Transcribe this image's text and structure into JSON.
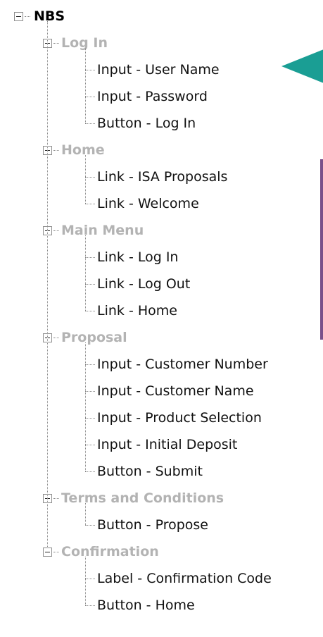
{
  "colors": {
    "root_text": "#000000",
    "group_text": "#b3b3b3",
    "leaf_text": "#111111",
    "connector": "#8a8a8a",
    "annotation_arrow": "#1a9e94",
    "annotation_bar": "#7a4f8a"
  },
  "tree": {
    "root": {
      "label": "NBS",
      "expanded": true,
      "icon": "collapse-icon"
    },
    "groups": [
      {
        "label": "Log In",
        "expanded": true,
        "items": [
          "Input - User Name",
          "Input - Password",
          "Button - Log In"
        ]
      },
      {
        "label": "Home",
        "expanded": true,
        "items": [
          "Link - ISA Proposals",
          "Link - Welcome"
        ]
      },
      {
        "label": "Main Menu",
        "expanded": true,
        "items": [
          "Link - Log In",
          "Link - Log Out",
          "Link - Home"
        ]
      },
      {
        "label": "Proposal",
        "expanded": true,
        "items": [
          "Input - Customer Number",
          "Input - Customer Name",
          "Input - Product Selection",
          "Input - Initial Deposit",
          "Button - Submit"
        ]
      },
      {
        "label": "Terms and Conditions",
        "expanded": true,
        "items": [
          "Button - Propose"
        ]
      },
      {
        "label": "Confirmation",
        "expanded": true,
        "items": [
          "Label - Confirmation Code",
          "Button - Home"
        ]
      }
    ]
  },
  "annotations": {
    "arrow_icon": "pointer-arrow-icon",
    "bar_icon": "vertical-bar-marker"
  }
}
